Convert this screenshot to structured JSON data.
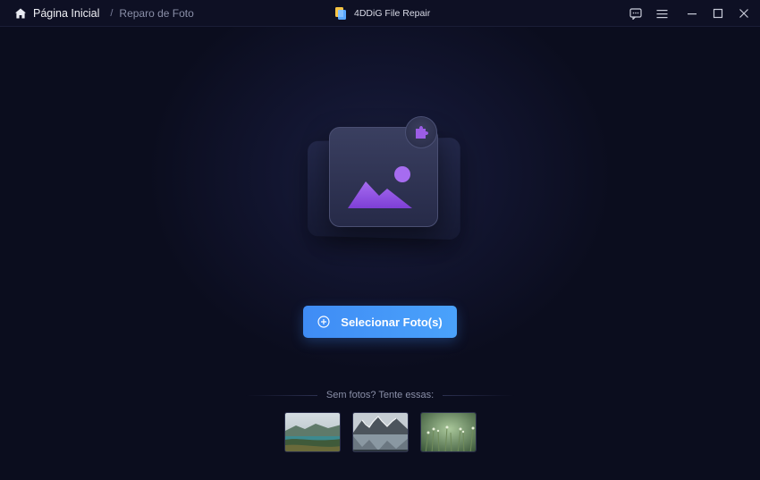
{
  "titlebar": {
    "breadcrumb_home": "Página Inicial",
    "breadcrumb_separator": "/",
    "breadcrumb_current": "Reparo de Foto",
    "app_name": "4DDiG File Repair"
  },
  "main": {
    "select_button_label": "Selecionar Foto(s)",
    "samples_label": "Sem fotos? Tente essas:"
  },
  "icons": {
    "home": "home-icon",
    "feedback": "feedback-icon",
    "menu": "menu-icon",
    "minimize": "minimize-icon",
    "maximize": "maximize-icon",
    "close": "close-icon",
    "plus": "plus-circle-icon",
    "puzzle": "puzzle-icon",
    "image": "image-icon"
  },
  "colors": {
    "accent": "#4296f7",
    "image_icon": "#9b5de5",
    "background": "#0b0d1e"
  }
}
